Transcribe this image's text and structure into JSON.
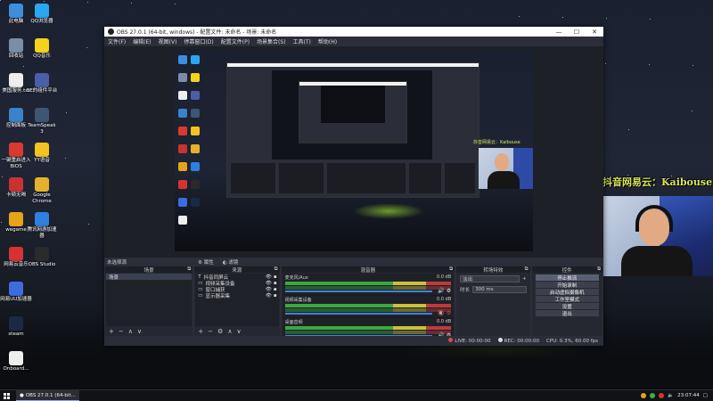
{
  "desktop": {
    "icons": [
      {
        "label": "此电脑",
        "color": "#3d8ede"
      },
      {
        "label": "QQ浏览器",
        "color": "#2aa7f0"
      },
      {
        "label": "回收站",
        "color": "#7a8ea6"
      },
      {
        "label": "QQ音乐",
        "color": "#f3d31c"
      },
      {
        "label": "美国服务.txt",
        "color": "#eeeeee"
      },
      {
        "label": "SE的组件平台",
        "color": "#4b5fa6"
      },
      {
        "label": "控制面板",
        "color": "#3a82c9"
      },
      {
        "label": "TeamSpeak 3",
        "color": "#3d5671"
      },
      {
        "label": "一键重启进入BIOS",
        "color": "#d83a30"
      },
      {
        "label": "YY语音",
        "color": "#f2c321"
      },
      {
        "label": "卡顿无喝",
        "color": "#c8322f"
      },
      {
        "label": "Google Chrome",
        "color": "#e4b12c"
      },
      {
        "label": "wegame",
        "color": "#e8a31a"
      },
      {
        "label": "腾讯网游加速器",
        "color": "#2f7fe0"
      },
      {
        "label": "网易云音乐",
        "color": "#d63232"
      },
      {
        "label": "OBS Studio",
        "color": "#2a2a2a"
      },
      {
        "label": "网易UU加速器",
        "color": "#3a6de0"
      },
      {
        "label": "steam",
        "color": "#1b2a44"
      },
      {
        "label": "Onboard...",
        "color": "#eeeeee"
      }
    ]
  },
  "overlay": {
    "text": "抖音网易云：Kaibouse"
  },
  "window": {
    "title": "OBS 27.0.1 (64-bit, windows) - 配置文件: 未命名 - 场景: 未命名",
    "controls": [
      "—",
      "☐",
      "✕"
    ],
    "menu": [
      "文件(F)",
      "编辑(E)",
      "视图(V)",
      "停靠窗口(D)",
      "配置文件(P)",
      "场景集合(S)",
      "工具(T)",
      "帮助(H)"
    ]
  },
  "status_row": {
    "label": "未选择源",
    "props": "属性",
    "filters": "滤镜"
  },
  "docks": {
    "scenes": {
      "title": "场景",
      "items": [
        "场景"
      ]
    },
    "sources": {
      "title": "来源",
      "items": [
        {
          "icon": "T",
          "label": "抖音同屏云"
        },
        {
          "icon": "▭",
          "label": "视频采集设备"
        },
        {
          "icon": "▭",
          "label": "窗口捕获"
        },
        {
          "icon": "▭",
          "label": "显示器采集"
        }
      ]
    },
    "mixer": {
      "title": "混音器",
      "channels": [
        {
          "name": "麦克风/Aux",
          "db": "0.0 dB"
        },
        {
          "name": "视频采集设备",
          "db": "0.0 dB"
        },
        {
          "name": "桌面音频",
          "db": "0.0 dB"
        }
      ]
    },
    "transitions": {
      "title": "转场特效",
      "type": "淡出",
      "duration_label": "时长",
      "duration": "300 ms"
    },
    "controls": {
      "title": "控件",
      "buttons": [
        "停止推流",
        "开始录制",
        "启动虚拟摄像机",
        "工作室模式",
        "设置",
        "退出"
      ]
    },
    "footer": {
      "add": "+",
      "remove": "−",
      "up": "∧",
      "down": "∨",
      "gear": "⚙"
    }
  },
  "statusbar": {
    "live": "LIVE: 00:00:00",
    "rec": "REC: 00:00:00",
    "cpu": "CPU: 0.3%, 60.00 fps"
  },
  "taskbar": {
    "app": "OBS 27.0.1 (64-bit...",
    "time": "23:07:44"
  }
}
